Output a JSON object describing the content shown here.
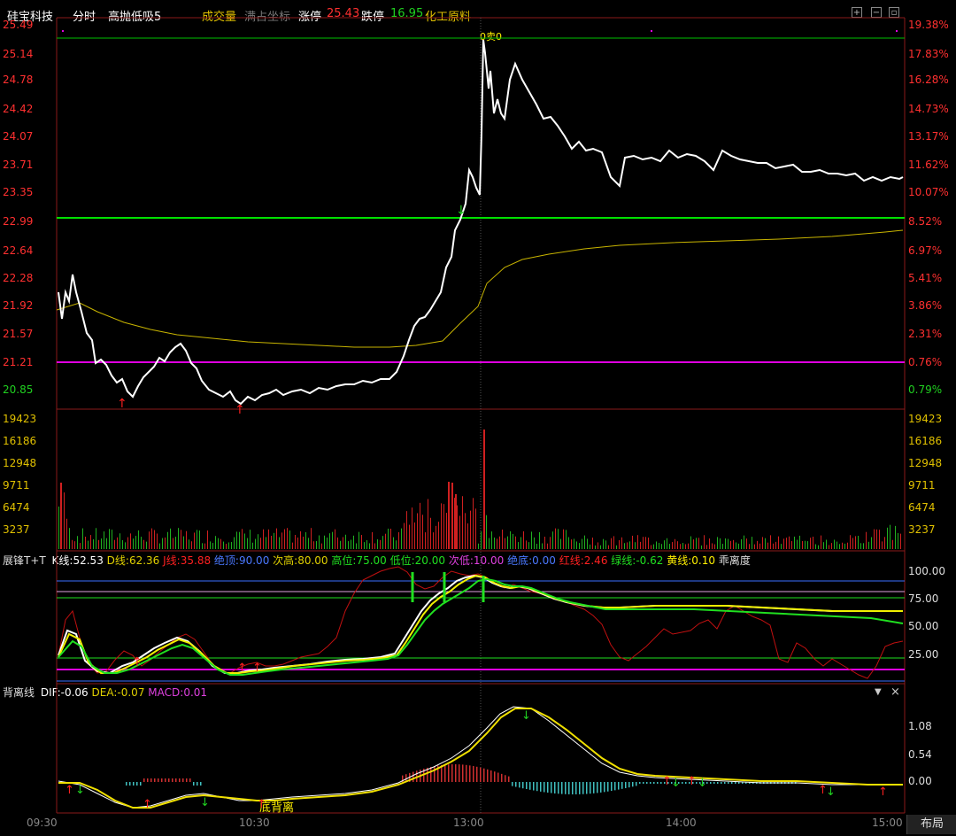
{
  "header": {
    "stock_name": "硅宝科技",
    "tab_timeshare": "分时",
    "indicator": "高抛低吸5",
    "volume_label": "成交量",
    "fullscreen_label": "满占坐标",
    "limit_up_label": "涨停",
    "limit_up_value": "25.43",
    "limit_down_label": "跌停",
    "limit_down_value": "16.95",
    "sector": "化工原料"
  },
  "price_axis": {
    "left": [
      "25.49",
      "25.14",
      "24.78",
      "24.42",
      "24.07",
      "23.71",
      "23.35",
      "22.99",
      "22.64",
      "22.28",
      "21.92",
      "21.57",
      "21.21",
      "20.85"
    ],
    "right": [
      "19.38%",
      "17.83%",
      "16.28%",
      "14.73%",
      "13.17%",
      "11.62%",
      "10.07%",
      "8.52%",
      "6.97%",
      "5.41%",
      "3.86%",
      "2.31%",
      "0.76%",
      "0.79%"
    ]
  },
  "volume_axis": [
    "19423",
    "16186",
    "12948",
    "9711",
    "6474",
    "3237"
  ],
  "kdj": {
    "name": "展锋T+T",
    "k_label": "K线:",
    "k_value": "52.53",
    "d_label": "D线:",
    "d_value": "62.36",
    "j_label": "J线:",
    "j_value": "35.88",
    "top_label": "绝顶:",
    "top_value": "90.00",
    "subhigh_label": "次高:",
    "subhigh_value": "80.00",
    "high_label": "高位:",
    "high_value": "75.00",
    "low_label": "低位:",
    "low_value": "20.00",
    "sublow_label": "次低:",
    "sublow_value": "10.00",
    "bottom_label": "绝底:",
    "bottom_value": "0.00",
    "red_label": "红线:",
    "red_value": "2.46",
    "green_label": "绿线:",
    "green_value": "-0.62",
    "yellow_label": "黄线:",
    "yellow_value": "0.10",
    "deviation_label": "乖离度",
    "axis": [
      "100.00",
      "75.00",
      "50.00",
      "25.00"
    ]
  },
  "macd": {
    "name": "背离线",
    "dif_label": "DIF:",
    "dif_value": "-0.06",
    "dea_label": "DEA:",
    "dea_value": "-0.07",
    "macd_label": "MACD:",
    "macd_value": "0.01",
    "axis": [
      "1.08",
      "0.54",
      "0.00"
    ],
    "annotation": "底背离"
  },
  "annotations": {
    "sell_marker": "0卖0"
  },
  "time_axis": [
    "09:30",
    "10:30",
    "13:00",
    "14:00",
    "15:00"
  ],
  "layout_button": "布局",
  "colors": {
    "price_line": "#ffffff",
    "avg_line": "#c8b400",
    "up": "#ff3030",
    "down": "#20c020",
    "magenta": "#e000e0",
    "green_line": "#00e000",
    "blue": "#3a6fff"
  }
}
